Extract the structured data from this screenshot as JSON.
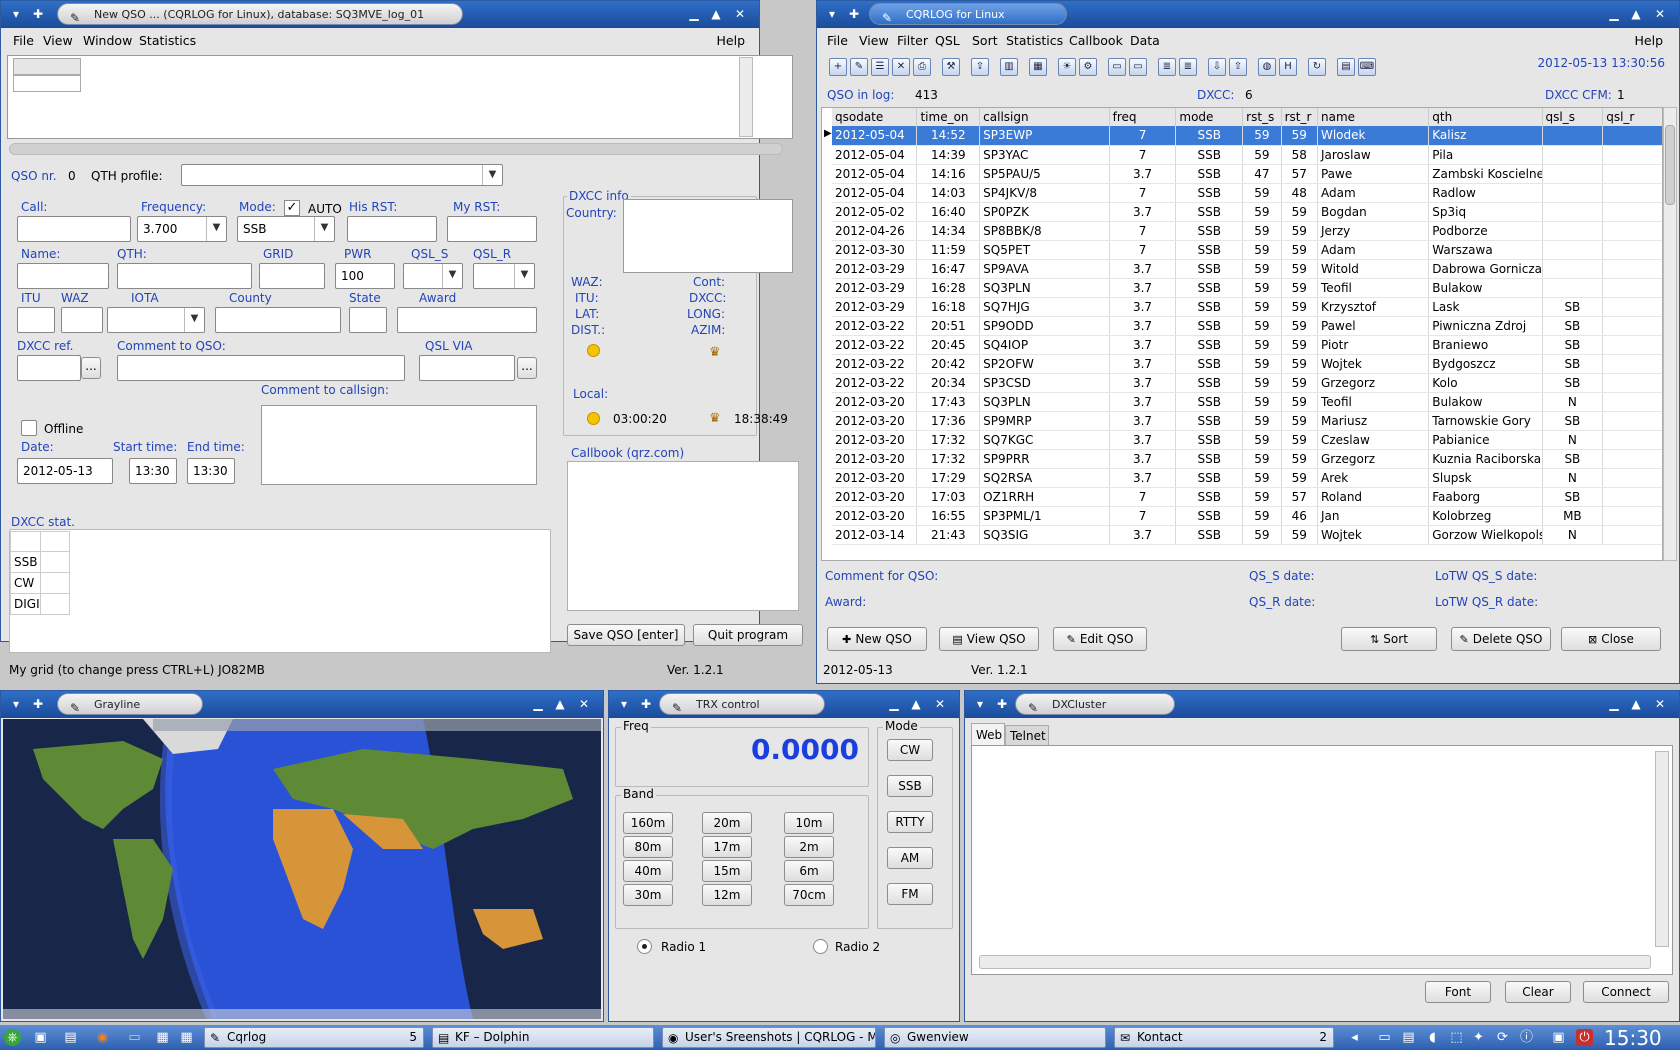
{
  "new_qso": {
    "title": "New QSO ... (CQRLOG for Linux), database: SQ3MVE_log_01",
    "menu": [
      "File",
      "View",
      "Window",
      "Statistics"
    ],
    "help": "Help",
    "qso_nr_label": "QSO nr.",
    "qso_nr": "0",
    "qth_profile_label": "QTH profile:",
    "call_label": "Call:",
    "freq_label": "Frequency:",
    "freq": "3.700",
    "mode_label": "Mode:",
    "mode": "SSB",
    "auto_label": "AUTO",
    "his_rst_label": "His RST:",
    "my_rst_label": "My RST:",
    "name_label": "Name:",
    "qth_label": "QTH:",
    "grid_label": "GRID",
    "pwr_label": "PWR",
    "pwr": "100",
    "qsl_s_label": "QSL_S",
    "qsl_r_label": "QSL_R",
    "itu_label": "ITU",
    "waz_label": "WAZ",
    "iota_label": "IOTA",
    "county_label": "County",
    "state_label": "State",
    "award_label": "Award",
    "dxcc_ref_label": "DXCC ref.",
    "comment_qso_label": "Comment to QSO:",
    "qsl_via_label": "QSL VIA",
    "dots": "...",
    "comment_call_label": "Comment to callsign:",
    "offline_label": "Offline",
    "date_label": "Date:",
    "date": "2012-05-13",
    "start_label": "Start time:",
    "start": "13:30",
    "end_label": "End time:",
    "end": "13:30",
    "dxcc_info": {
      "title": "DXCC info",
      "country": "Country:",
      "waz": "WAZ:",
      "cont": "Cont:",
      "itu": "ITU:",
      "dxcc": "DXCC:",
      "lat": "LAT:",
      "long": "LONG:",
      "dist": "DIST.:",
      "azim": "AZIM:",
      "local": "Local:",
      "sunrise": "03:00:20",
      "sunset": "18:38:49"
    },
    "callbook_title": "Callbook (qrz.com)",
    "dxcc_stat_title": "DXCC stat.",
    "dxcc_stat_rows": [
      "SSB",
      "CW",
      "DIGI"
    ],
    "save_btn": "Save QSO [enter]",
    "quit_btn": "Quit program",
    "status_left": "My grid (to change press CTRL+L) JO82MB",
    "status_ver": "Ver. 1.2.1"
  },
  "main": {
    "title": "CQRLOG for Linux",
    "menu": [
      "File",
      "View",
      "Filter",
      "QSL",
      "Sort",
      "Statistics",
      "Callbook",
      "Data"
    ],
    "help": "Help",
    "datetime": "2012-05-13  13:30:56",
    "qso_in_log_label": "QSO in log:",
    "qso_in_log": "413",
    "dxcc_label": "DXCC:",
    "dxcc": "6",
    "dxcc_cfm_label": "DXCC CFM:",
    "dxcc_cfm": "1",
    "columns": [
      "qsodate",
      "time_on",
      "callsign",
      "freq",
      "mode",
      "rst_s",
      "rst_r",
      "name",
      "qth",
      "qsl_s",
      "qsl_r"
    ],
    "rows": [
      [
        "2012-05-04",
        "14:52",
        "SP3EWP",
        "7",
        "SSB",
        "59",
        "59",
        "Wlodek",
        "Kalisz",
        "",
        ""
      ],
      [
        "2012-05-04",
        "14:39",
        "SP3YAC",
        "7",
        "SSB",
        "59",
        "58",
        "Jaroslaw",
        "Pila",
        "",
        ""
      ],
      [
        "2012-05-04",
        "14:16",
        "SP5PAU/5",
        "3.7",
        "SSB",
        "47",
        "57",
        "Pawe",
        "Zambski Koscielne",
        "",
        ""
      ],
      [
        "2012-05-04",
        "14:03",
        "SP4JKV/8",
        "7",
        "SSB",
        "59",
        "48",
        "Adam",
        "Radlow",
        "",
        ""
      ],
      [
        "2012-05-02",
        "16:40",
        "SP0PZK",
        "3.7",
        "SSB",
        "59",
        "59",
        "Bogdan",
        "Sp3iq",
        "",
        ""
      ],
      [
        "2012-04-26",
        "14:34",
        "SP8BBK/8",
        "7",
        "SSB",
        "59",
        "59",
        "Jerzy",
        "Podborze",
        "",
        ""
      ],
      [
        "2012-03-30",
        "11:59",
        "SQ5PET",
        "7",
        "SSB",
        "59",
        "59",
        "Adam",
        "Warszawa",
        "",
        ""
      ],
      [
        "2012-03-29",
        "16:47",
        "SP9AVA",
        "3.7",
        "SSB",
        "59",
        "59",
        "Witold",
        "Dabrowa Gornicza",
        "",
        ""
      ],
      [
        "2012-03-29",
        "16:28",
        "SQ3PLN",
        "3.7",
        "SSB",
        "59",
        "59",
        "Teofil",
        "Bulakow",
        "",
        ""
      ],
      [
        "2012-03-29",
        "16:18",
        "SQ7HJG",
        "3.7",
        "SSB",
        "59",
        "59",
        "Krzysztof",
        "Lask",
        "SB",
        ""
      ],
      [
        "2012-03-22",
        "20:51",
        "SP9ODD",
        "3.7",
        "SSB",
        "59",
        "59",
        "Pawel",
        "Piwniczna Zdroj",
        "SB",
        ""
      ],
      [
        "2012-03-22",
        "20:45",
        "SQ4IOP",
        "3.7",
        "SSB",
        "59",
        "59",
        "Piotr",
        "Braniewo",
        "SB",
        ""
      ],
      [
        "2012-03-22",
        "20:42",
        "SP2OFW",
        "3.7",
        "SSB",
        "59",
        "59",
        "Wojtek",
        "Bydgoszcz",
        "SB",
        ""
      ],
      [
        "2012-03-22",
        "20:34",
        "SP3CSD",
        "3.7",
        "SSB",
        "59",
        "59",
        "Grzegorz",
        "Kolo",
        "SB",
        ""
      ],
      [
        "2012-03-20",
        "17:43",
        "SQ3PLN",
        "3.7",
        "SSB",
        "59",
        "59",
        "Teofil",
        "Bulakow",
        "N",
        ""
      ],
      [
        "2012-03-20",
        "17:36",
        "SP9MRP",
        "3.7",
        "SSB",
        "59",
        "59",
        "Mariusz",
        "Tarnowskie Gory",
        "SB",
        ""
      ],
      [
        "2012-03-20",
        "17:32",
        "SQ7KGC",
        "3.7",
        "SSB",
        "59",
        "59",
        "Czeslaw",
        "Pabianice",
        "N",
        ""
      ],
      [
        "2012-03-20",
        "17:32",
        "SP9PRR",
        "3.7",
        "SSB",
        "59",
        "59",
        "Grzegorz",
        "Kuznia Raciborska",
        "SB",
        ""
      ],
      [
        "2012-03-20",
        "17:29",
        "SQ2RSA",
        "3.7",
        "SSB",
        "59",
        "59",
        "Arek",
        "Slupsk",
        "N",
        ""
      ],
      [
        "2012-03-20",
        "17:03",
        "OZ1RRH",
        "7",
        "SSB",
        "59",
        "57",
        "Roland",
        "Faaborg",
        "SB",
        ""
      ],
      [
        "2012-03-20",
        "16:55",
        "SP3PML/1",
        "7",
        "SSB",
        "59",
        "46",
        "Jan",
        "Kolobrzeg",
        "MB",
        ""
      ],
      [
        "2012-03-14",
        "21:43",
        "SQ3SIG",
        "3.7",
        "SSB",
        "59",
        "59",
        "Wojtek",
        "Gorzow Wielkopols",
        "N",
        ""
      ]
    ],
    "comment_label": "Comment for QSO:",
    "award_label": "Award:",
    "qs_s_date": "QS_S date:",
    "qs_r_date": "QS_R date:",
    "lotw_s": "LoTW QS_S date:",
    "lotw_r": "LoTW QS_R date:",
    "buttons": {
      "new": "New QSO",
      "view": "View QSO",
      "edit": "Edit QSO",
      "sort": "Sort",
      "delete": "Delete QSO",
      "close": "Close"
    },
    "status_date": "2012-05-13",
    "status_ver": "Ver. 1.2.1"
  },
  "grayline": {
    "title": "Grayline"
  },
  "trx": {
    "title": "TRX control",
    "freq_label": "Freq",
    "freq": "0.0000",
    "mode_label": "Mode",
    "band_label": "Band",
    "bands": [
      "160m",
      "20m",
      "10m",
      "80m",
      "17m",
      "2m",
      "40m",
      "15m",
      "6m",
      "30m",
      "12m",
      "70cm"
    ],
    "modes": [
      "CW",
      "SSB",
      "RTTY",
      "AM",
      "FM"
    ],
    "radio1": "Radio 1",
    "radio2": "Radio 2"
  },
  "dxcluster": {
    "title": "DXCluster",
    "tabs": [
      "Web",
      "Telnet"
    ],
    "font": "Font",
    "clear": "Clear",
    "connect": "Connect"
  },
  "taskbar": {
    "tasks": [
      "Cqrlog",
      "KF – Dolphin",
      "User's Sreenshots | CQRLOG - Mo",
      "Gwenview",
      "Kontact"
    ],
    "cqrlog_count": "5",
    "kontact_count": "2",
    "clock": "15:30"
  },
  "colors": {
    "titlebar": "#2f6fc8",
    "label_blue": "#2344b8",
    "selection": "#3b7bd8",
    "freq_blue": "#1b3ee0"
  }
}
